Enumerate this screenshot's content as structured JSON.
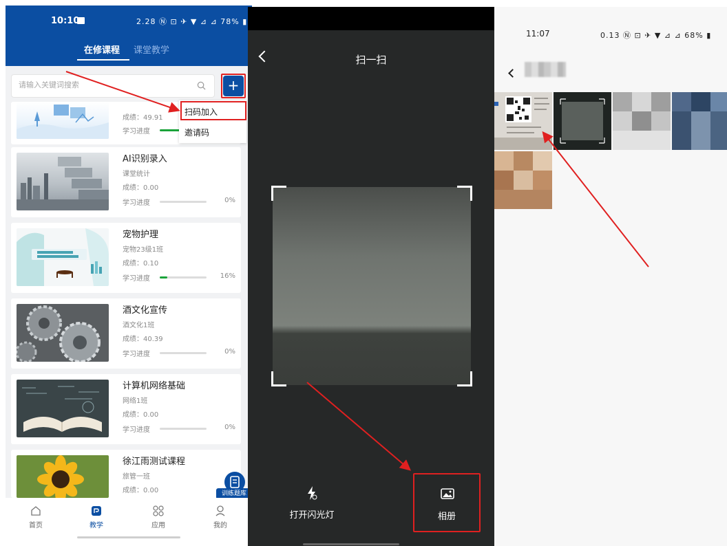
{
  "panel1": {
    "status": {
      "time": "10:10",
      "right": "2.28 Ⓝ ⊡ ✈ ▼ ⊿ ⊿ 78% ▮"
    },
    "tabs": [
      {
        "label": "在修课程"
      },
      {
        "label": "课堂教学"
      }
    ],
    "search": {
      "placeholder": "请输入关键词搜索"
    },
    "plus_label": "+",
    "menu": [
      {
        "label": "扫码加入"
      },
      {
        "label": "邀请码"
      }
    ],
    "progress_label": "学习进度",
    "courses": [
      {
        "title": "",
        "class": "",
        "score": "成绩：49.91",
        "progress": 0.5,
        "pct": ""
      },
      {
        "title": "AI识别录入",
        "class": "课堂统计",
        "score": "成绩：0.00",
        "progress": 0,
        "pct": "0%"
      },
      {
        "title": "宠物护理",
        "class": "宠物23级1班",
        "score": "成绩：0.10",
        "progress": 0.16,
        "pct": "16%"
      },
      {
        "title": "酒文化宣传",
        "class": "酒文化1班",
        "score": "成绩：40.39",
        "progress": 0,
        "pct": "0%"
      },
      {
        "title": "计算机网络基础",
        "class": "网络1班",
        "score": "成绩：0.00",
        "progress": 0,
        "pct": "0%"
      },
      {
        "title": "徐江雨测试课程",
        "class": "旅管一班",
        "score": "成绩：0.00",
        "progress": 0,
        "pct": ""
      }
    ],
    "float_label": "训练题库",
    "nav": [
      {
        "label": "首页"
      },
      {
        "label": "教学"
      },
      {
        "label": "应用"
      },
      {
        "label": "我的"
      }
    ],
    "accent": "#0b4ea2",
    "highlight": "#e02020"
  },
  "panel2": {
    "title": "扫一扫",
    "flash_label": "打开闪光灯",
    "album_label": "相册"
  },
  "panel3": {
    "status": {
      "time": "11:07",
      "right": "0.13 Ⓝ ⊡ ✈ ▼ ⊿ ⊿ 68% ▮"
    }
  }
}
